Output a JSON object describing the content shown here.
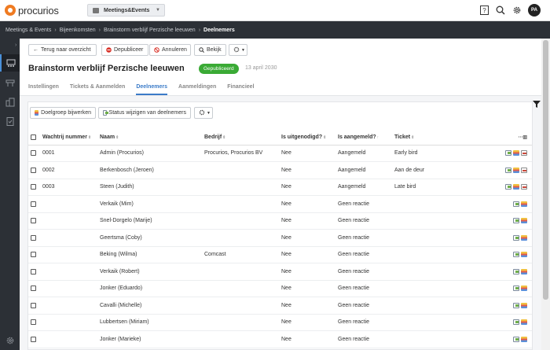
{
  "header": {
    "logo_text": "procurios",
    "module": "Meetings&Events",
    "icons": [
      "help-icon",
      "search-icon",
      "gear-icon"
    ],
    "avatar": "PA"
  },
  "breadcrumb": [
    "Meetings & Events",
    "Bijeenkomsten",
    "Brainstorm verblijf Perzische leeuwen",
    "Deelnemers"
  ],
  "sidebar": {
    "items": [
      "events-icon",
      "dashboard-icon",
      "building-icon",
      "checklist-icon",
      "settings-icon"
    ]
  },
  "toolbar": {
    "back": "Terug naar overzicht",
    "unpublish": "Depubliceer",
    "cancel": "Annuleren",
    "view": "Bekijk"
  },
  "event": {
    "title": "Brainstorm verblijf Perzische leeuwen",
    "status": "Gepubliceerd",
    "date": "13 april 2030"
  },
  "tabs": [
    "Instellingen",
    "Tickets & Aanmelden",
    "Deelnemers",
    "Aanmeldingen",
    "Financieel"
  ],
  "actions": {
    "target_group": "Doelgroep bijwerken",
    "change_status": "Status wijzigen van deelnemers"
  },
  "table": {
    "columns": [
      "Wachtrij nummer",
      "Naam",
      "Bedrijf",
      "Is uitgenodigd?",
      "Is aangemeld?",
      "Ticket"
    ],
    "rows": [
      {
        "queue": "0001",
        "name": "Admin (Procurios)",
        "company": "Procurios, Procurios BV",
        "invited": "Nee",
        "registered": "Aangemeld",
        "ticket": "Early bird"
      },
      {
        "queue": "0002",
        "name": "Berkenbosch (Jeroen)",
        "company": "",
        "invited": "Nee",
        "registered": "Aangemeld",
        "ticket": "Aan de deur"
      },
      {
        "queue": "0003",
        "name": "Steen (Judith)",
        "company": "",
        "invited": "Nee",
        "registered": "Aangemeld",
        "ticket": "Late bird"
      },
      {
        "queue": "",
        "name": "Verkaik (Mim)",
        "company": "",
        "invited": "Nee",
        "registered": "Geen reactie",
        "ticket": ""
      },
      {
        "queue": "",
        "name": "Snel-Dorgelo (Marije)",
        "company": "",
        "invited": "Nee",
        "registered": "Geen reactie",
        "ticket": ""
      },
      {
        "queue": "",
        "name": "Geertsma (Coby)",
        "company": "",
        "invited": "Nee",
        "registered": "Geen reactie",
        "ticket": ""
      },
      {
        "queue": "",
        "name": "Beking (Wilma)",
        "company": "Comcast",
        "invited": "Nee",
        "registered": "Geen reactie",
        "ticket": ""
      },
      {
        "queue": "",
        "name": "Verkaik (Robert)",
        "company": "",
        "invited": "Nee",
        "registered": "Geen reactie",
        "ticket": ""
      },
      {
        "queue": "",
        "name": "Jonker (Eduardo)",
        "company": "",
        "invited": "Nee",
        "registered": "Geen reactie",
        "ticket": ""
      },
      {
        "queue": "",
        "name": "Cavalli (Michelle)",
        "company": "",
        "invited": "Nee",
        "registered": "Geen reactie",
        "ticket": ""
      },
      {
        "queue": "",
        "name": "Lubbertsen (Miriam)",
        "company": "",
        "invited": "Nee",
        "registered": "Geen reactie",
        "ticket": ""
      },
      {
        "queue": "",
        "name": "Jonker (Marieke)",
        "company": "",
        "invited": "Nee",
        "registered": "Geen reactie",
        "ticket": ""
      }
    ]
  }
}
